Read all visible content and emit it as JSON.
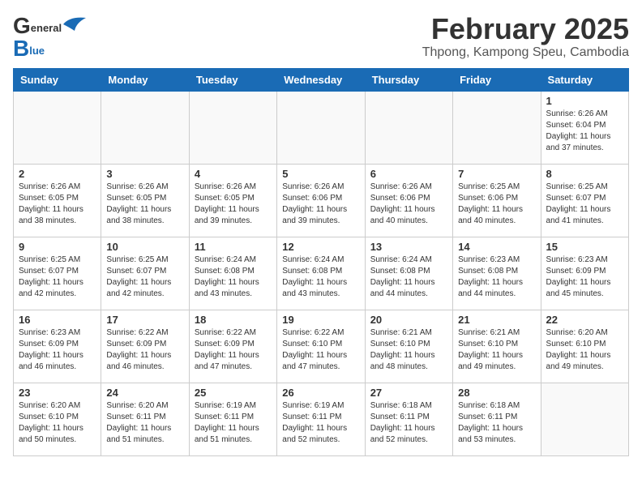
{
  "header": {
    "logo_general": "General",
    "logo_blue": "Blue",
    "month_title": "February 2025",
    "location": "Thpong, Kampong Speu, Cambodia"
  },
  "weekdays": [
    "Sunday",
    "Monday",
    "Tuesday",
    "Wednesday",
    "Thursday",
    "Friday",
    "Saturday"
  ],
  "weeks": [
    [
      {
        "day": "",
        "info": ""
      },
      {
        "day": "",
        "info": ""
      },
      {
        "day": "",
        "info": ""
      },
      {
        "day": "",
        "info": ""
      },
      {
        "day": "",
        "info": ""
      },
      {
        "day": "",
        "info": ""
      },
      {
        "day": "1",
        "info": "Sunrise: 6:26 AM\nSunset: 6:04 PM\nDaylight: 11 hours and 37 minutes."
      }
    ],
    [
      {
        "day": "2",
        "info": "Sunrise: 6:26 AM\nSunset: 6:05 PM\nDaylight: 11 hours and 38 minutes."
      },
      {
        "day": "3",
        "info": "Sunrise: 6:26 AM\nSunset: 6:05 PM\nDaylight: 11 hours and 38 minutes."
      },
      {
        "day": "4",
        "info": "Sunrise: 6:26 AM\nSunset: 6:05 PM\nDaylight: 11 hours and 39 minutes."
      },
      {
        "day": "5",
        "info": "Sunrise: 6:26 AM\nSunset: 6:06 PM\nDaylight: 11 hours and 39 minutes."
      },
      {
        "day": "6",
        "info": "Sunrise: 6:26 AM\nSunset: 6:06 PM\nDaylight: 11 hours and 40 minutes."
      },
      {
        "day": "7",
        "info": "Sunrise: 6:25 AM\nSunset: 6:06 PM\nDaylight: 11 hours and 40 minutes."
      },
      {
        "day": "8",
        "info": "Sunrise: 6:25 AM\nSunset: 6:07 PM\nDaylight: 11 hours and 41 minutes."
      }
    ],
    [
      {
        "day": "9",
        "info": "Sunrise: 6:25 AM\nSunset: 6:07 PM\nDaylight: 11 hours and 42 minutes."
      },
      {
        "day": "10",
        "info": "Sunrise: 6:25 AM\nSunset: 6:07 PM\nDaylight: 11 hours and 42 minutes."
      },
      {
        "day": "11",
        "info": "Sunrise: 6:24 AM\nSunset: 6:08 PM\nDaylight: 11 hours and 43 minutes."
      },
      {
        "day": "12",
        "info": "Sunrise: 6:24 AM\nSunset: 6:08 PM\nDaylight: 11 hours and 43 minutes."
      },
      {
        "day": "13",
        "info": "Sunrise: 6:24 AM\nSunset: 6:08 PM\nDaylight: 11 hours and 44 minutes."
      },
      {
        "day": "14",
        "info": "Sunrise: 6:23 AM\nSunset: 6:08 PM\nDaylight: 11 hours and 44 minutes."
      },
      {
        "day": "15",
        "info": "Sunrise: 6:23 AM\nSunset: 6:09 PM\nDaylight: 11 hours and 45 minutes."
      }
    ],
    [
      {
        "day": "16",
        "info": "Sunrise: 6:23 AM\nSunset: 6:09 PM\nDaylight: 11 hours and 46 minutes."
      },
      {
        "day": "17",
        "info": "Sunrise: 6:22 AM\nSunset: 6:09 PM\nDaylight: 11 hours and 46 minutes."
      },
      {
        "day": "18",
        "info": "Sunrise: 6:22 AM\nSunset: 6:09 PM\nDaylight: 11 hours and 47 minutes."
      },
      {
        "day": "19",
        "info": "Sunrise: 6:22 AM\nSunset: 6:10 PM\nDaylight: 11 hours and 47 minutes."
      },
      {
        "day": "20",
        "info": "Sunrise: 6:21 AM\nSunset: 6:10 PM\nDaylight: 11 hours and 48 minutes."
      },
      {
        "day": "21",
        "info": "Sunrise: 6:21 AM\nSunset: 6:10 PM\nDaylight: 11 hours and 49 minutes."
      },
      {
        "day": "22",
        "info": "Sunrise: 6:20 AM\nSunset: 6:10 PM\nDaylight: 11 hours and 49 minutes."
      }
    ],
    [
      {
        "day": "23",
        "info": "Sunrise: 6:20 AM\nSunset: 6:10 PM\nDaylight: 11 hours and 50 minutes."
      },
      {
        "day": "24",
        "info": "Sunrise: 6:20 AM\nSunset: 6:11 PM\nDaylight: 11 hours and 51 minutes."
      },
      {
        "day": "25",
        "info": "Sunrise: 6:19 AM\nSunset: 6:11 PM\nDaylight: 11 hours and 51 minutes."
      },
      {
        "day": "26",
        "info": "Sunrise: 6:19 AM\nSunset: 6:11 PM\nDaylight: 11 hours and 52 minutes."
      },
      {
        "day": "27",
        "info": "Sunrise: 6:18 AM\nSunset: 6:11 PM\nDaylight: 11 hours and 52 minutes."
      },
      {
        "day": "28",
        "info": "Sunrise: 6:18 AM\nSunset: 6:11 PM\nDaylight: 11 hours and 53 minutes."
      },
      {
        "day": "",
        "info": ""
      }
    ]
  ]
}
